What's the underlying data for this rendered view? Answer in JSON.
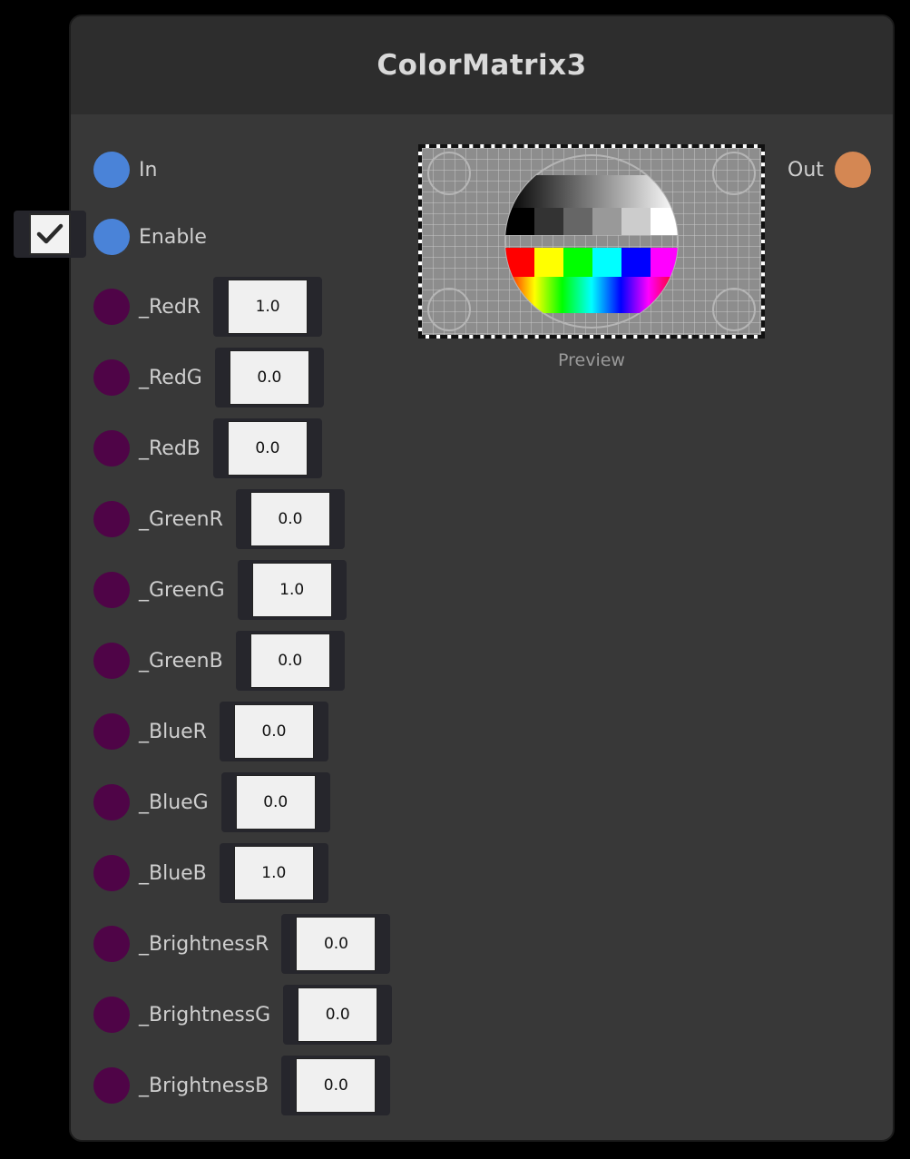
{
  "node": {
    "title": "ColorMatrix3",
    "inputs": {
      "in": "In",
      "enable": "Enable"
    },
    "enable_checked": true,
    "output": "Out",
    "preview": {
      "caption": "Preview"
    },
    "params": [
      {
        "label": "_RedR",
        "value": "1.0"
      },
      {
        "label": "_RedG",
        "value": "0.0"
      },
      {
        "label": "_RedB",
        "value": "0.0"
      },
      {
        "label": "_GreenR",
        "value": "0.0"
      },
      {
        "label": "_GreenG",
        "value": "1.0"
      },
      {
        "label": "_GreenB",
        "value": "0.0"
      },
      {
        "label": "_BlueR",
        "value": "0.0"
      },
      {
        "label": "_BlueG",
        "value": "0.0"
      },
      {
        "label": "_BlueB",
        "value": "1.0"
      },
      {
        "label": "_BrightnessR",
        "value": "0.0"
      },
      {
        "label": "_BrightnessG",
        "value": "0.0"
      },
      {
        "label": "_BrightnessB",
        "value": "0.0"
      }
    ]
  },
  "colors": {
    "node_bg": "#383838",
    "header_bg": "#2d2d2d",
    "input_port": "#4a83d8",
    "param_port": "#4f0447",
    "output_port": "#d48753"
  },
  "icons": [
    "checkmark-icon",
    "test-pattern-image"
  ]
}
